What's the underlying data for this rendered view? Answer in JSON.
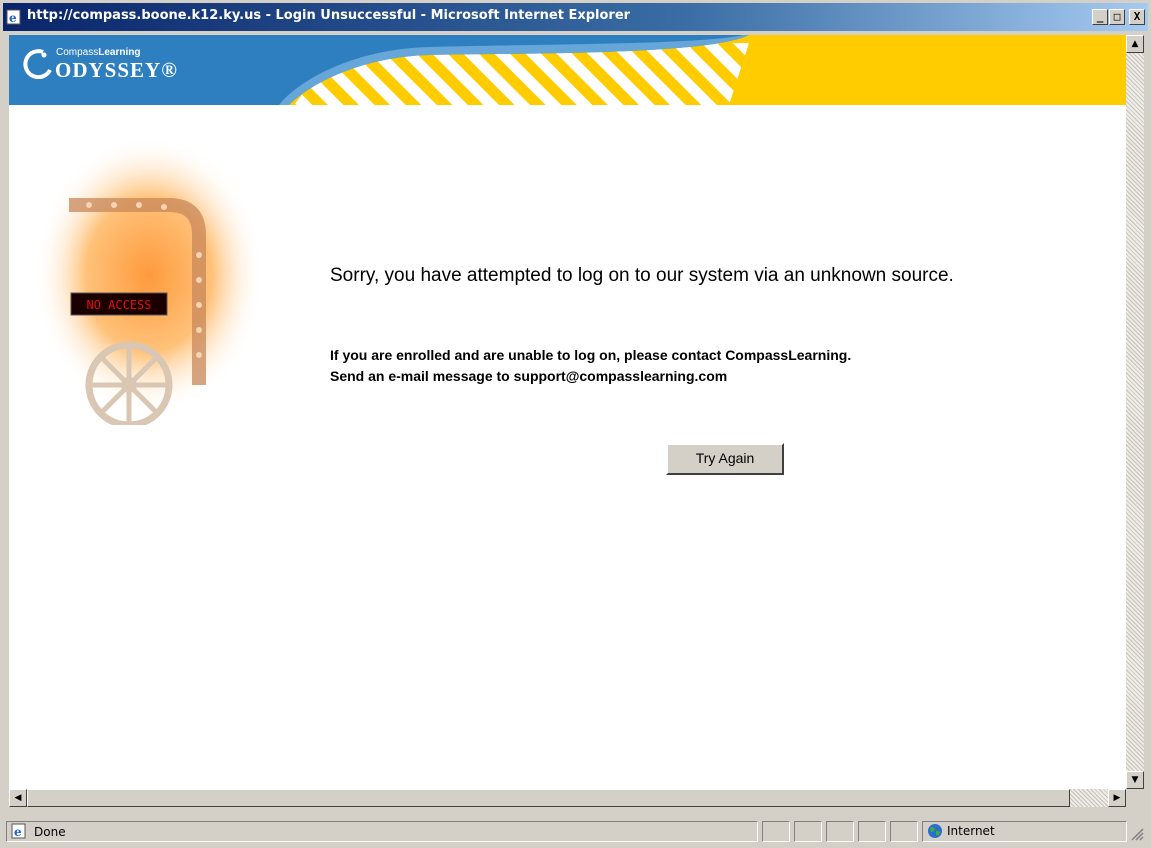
{
  "window": {
    "title": "http://compass.boone.k12.ky.us - Login Unsuccessful - Microsoft Internet Explorer",
    "minimize_glyph": "_",
    "maximize_glyph": "□",
    "close_glyph": "X"
  },
  "banner": {
    "brand_prefix": "Compass",
    "brand_suffix": "Learning",
    "product_name": "ODYSSEY®",
    "colors": {
      "blue": "#2e7fc0",
      "yellow": "#ffcc00"
    }
  },
  "illustration": {
    "sign_text": "NO ACCESS"
  },
  "message": {
    "heading": "Sorry, you have attempted to log on to our system via an unknown source.",
    "line1": "If you are enrolled and are unable to log on, please contact CompassLearning.",
    "line2": "Send an e-mail message to support@compasslearning.com"
  },
  "button": {
    "try_again_label": "Try Again"
  },
  "statusbar": {
    "status_text": "Done",
    "zone_text": "Internet"
  },
  "icons": {
    "title": "ie-page-icon",
    "status": "ie-page-icon",
    "zone": "globe-icon"
  }
}
